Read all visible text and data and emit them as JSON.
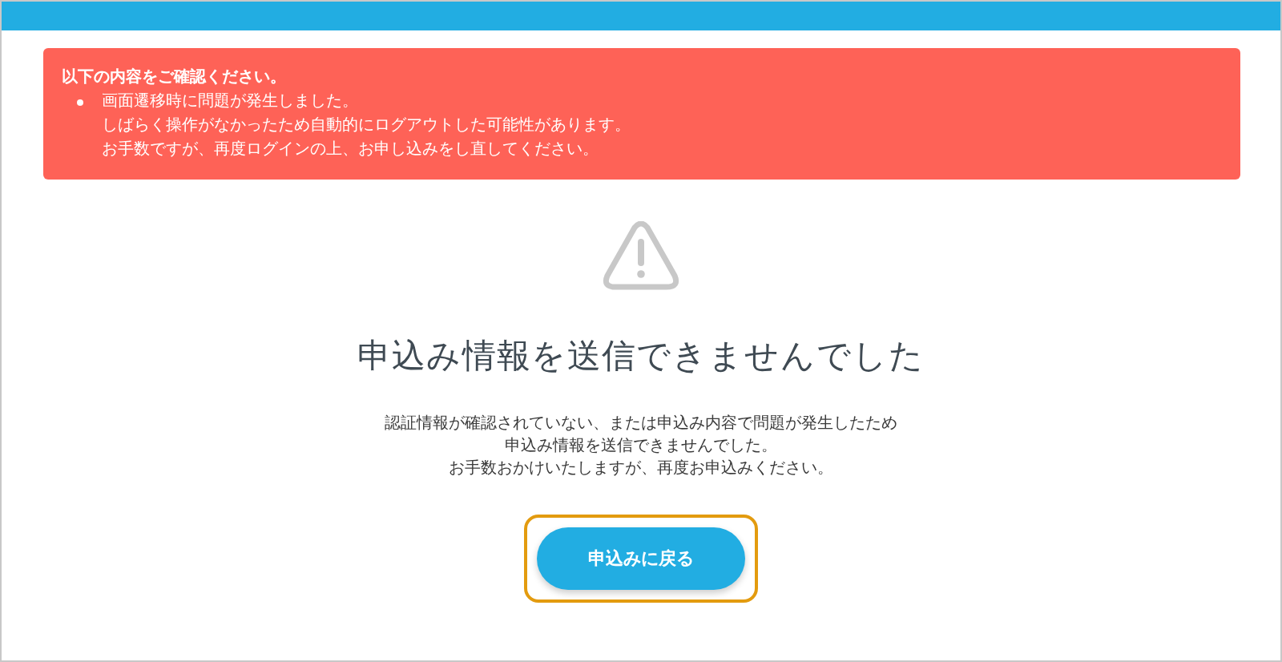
{
  "alert": {
    "heading": "以下の内容をご確認ください。",
    "items": [
      {
        "lines": [
          "画面遷移時に問題が発生しました。",
          "しばらく操作がなかったため自動的にログアウトした可能性があります。",
          "お手数ですが、再度ログインの上、お申し込みをし直してください。"
        ]
      }
    ]
  },
  "result": {
    "title": "申込み情報を送信できませんでした",
    "message": [
      "認証情報が確認されていない、または申込み内容で問題が発生したため",
      "申込み情報を送信できませんでした。",
      "お手数おかけいたしますが、再度お申込みください。"
    ],
    "button": {
      "label": "申込みに戻る",
      "highlighted": true
    }
  }
}
